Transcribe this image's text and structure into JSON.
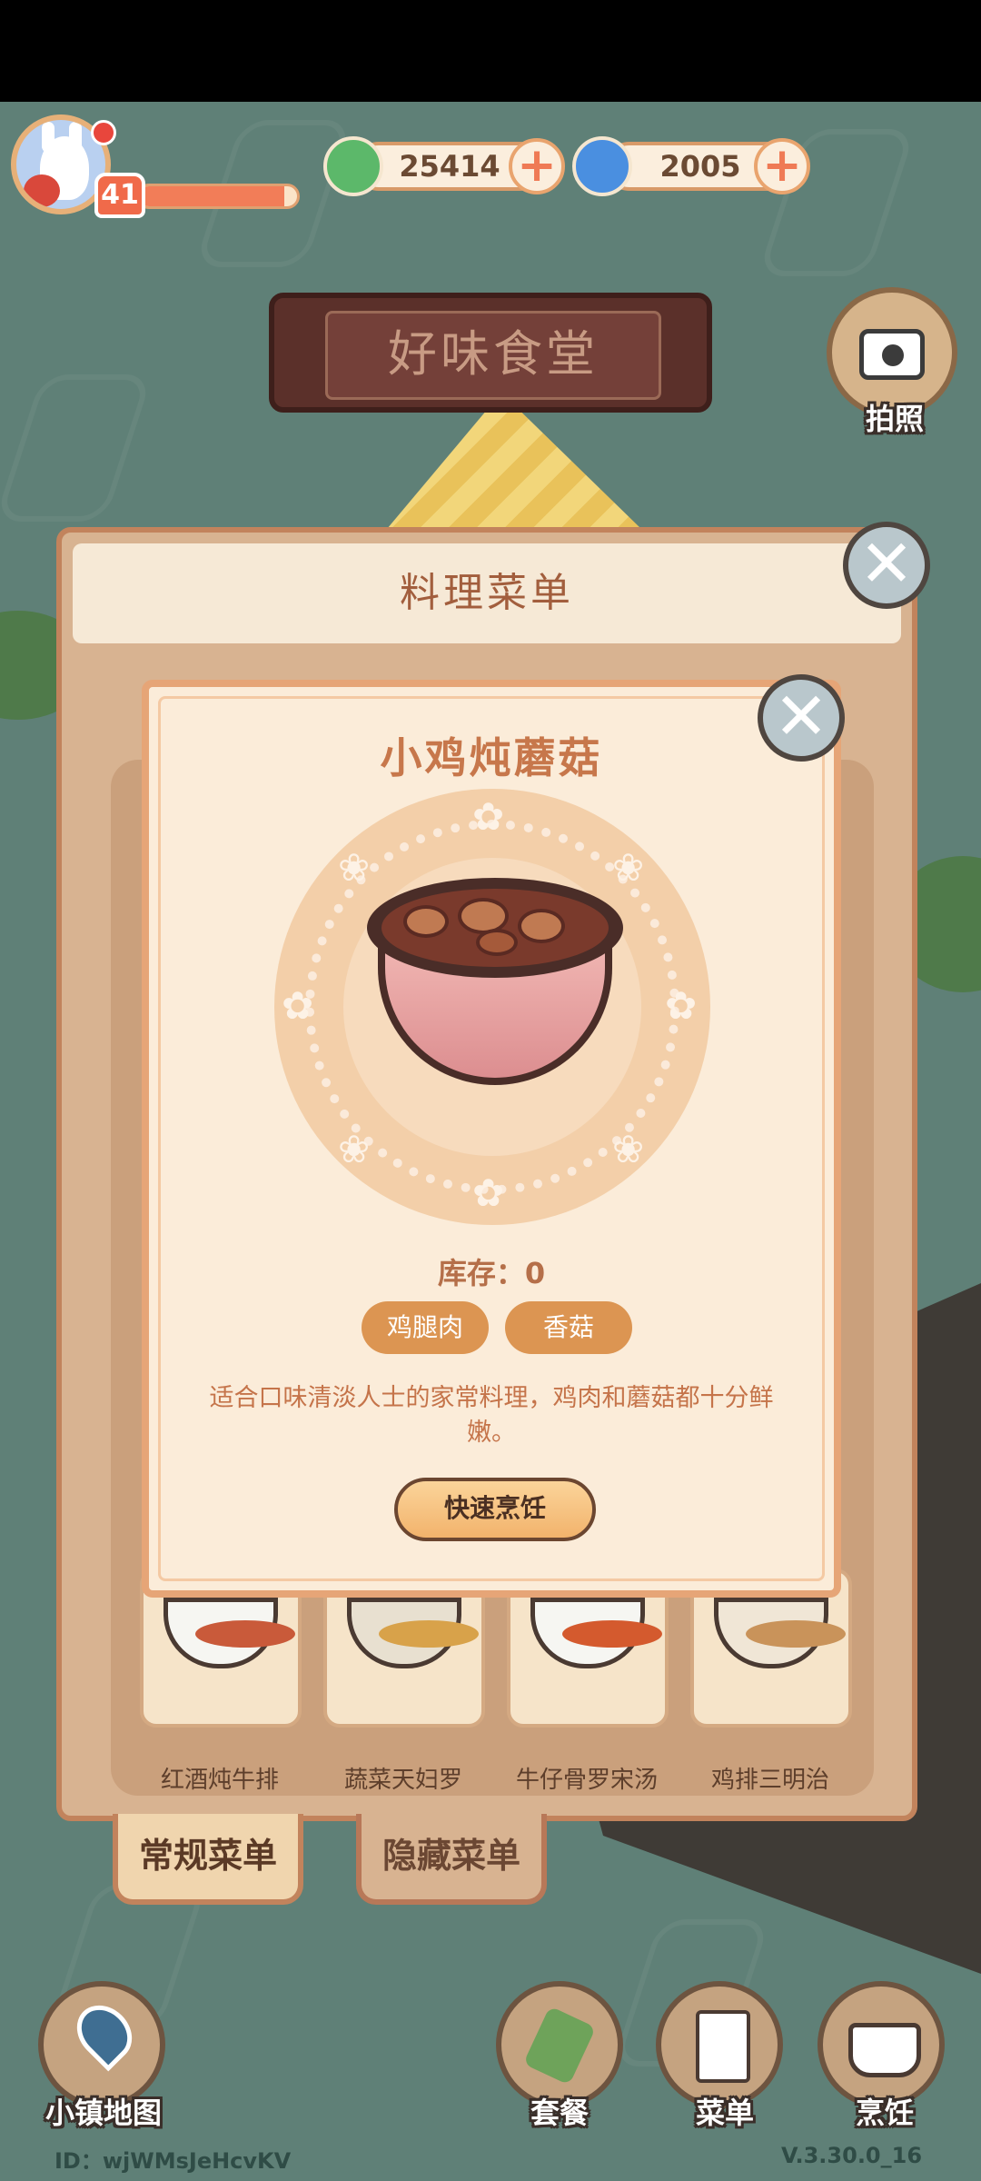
{
  "header": {
    "level": "41",
    "currency": [
      {
        "name": "clover-coin",
        "value": "25414",
        "color": "#5cb86a"
      },
      {
        "name": "spiral-gem",
        "value": "2005",
        "color": "#4a8fe0"
      }
    ],
    "restaurant_sign": "好味食堂",
    "camera_label": "拍照"
  },
  "menu": {
    "title": "料理菜单",
    "dishes": [
      "红酒炖牛排",
      "蔬菜天妇罗",
      "牛仔骨罗宋汤",
      "鸡排三明治"
    ],
    "tabs": [
      "常规菜单",
      "隐藏菜单"
    ]
  },
  "popup": {
    "title": "小鸡炖蘑菇",
    "stock": "库存：0",
    "ingredients": [
      "鸡腿肉",
      "香菇"
    ],
    "description": "适合口味清淡人士的家常料理，鸡肉和蘑菇都十分鲜嫩。",
    "cook_button": "快速烹饪"
  },
  "bottom_nav": {
    "map": "小镇地图",
    "set_meal": "套餐",
    "menu": "菜单",
    "cook": "烹饪"
  },
  "footer": {
    "id": "ID：wjWMsJeHcvKV",
    "version": "V.3.30.0_16"
  },
  "colors": {
    "background": "#5f8077",
    "panel": "#d8b391",
    "popup": "#fbecd9",
    "accent": "#dc9552"
  }
}
